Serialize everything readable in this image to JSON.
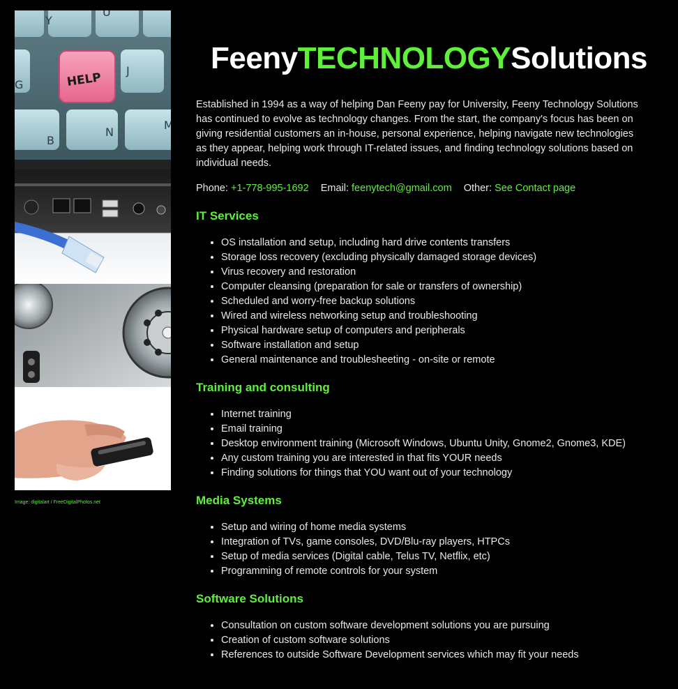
{
  "header": {
    "title_part1": "Feeny",
    "title_part2": "TECHNOLOGY",
    "title_part3": "Solutions"
  },
  "intro": "Established in 1994 as a way of helping Dan Feeny pay for University, Feeny Technology Solutions has continued to evolve as technology changes. From the start, the company's focus has been on giving residential customers an in-house, personal experience, helping navigate new technologies as they appear, helping work through IT-related issues, and finding technology solutions based on individual needs.",
  "contact": {
    "phone_label": "Phone:",
    "phone": "+1-778-995-1692",
    "email_label": "Email:",
    "email": "feenytech@gmail.com",
    "other_label": "Other:",
    "other_link": "See Contact page"
  },
  "sidebar": {
    "help_key_label": "HELP",
    "key_labels": [
      "Y",
      "U",
      "G",
      "J",
      "B",
      "N",
      "M"
    ],
    "credit": "Image: digitalart / FreeDigitalPhotos.net"
  },
  "sections": [
    {
      "title": "IT Services",
      "items": [
        "OS installation and setup, including hard drive contents transfers",
        "Storage loss recovery (excluding physically damaged storage devices)",
        "Virus recovery and restoration",
        "Computer cleansing (preparation for sale or transfers of ownership)",
        "Scheduled and worry-free backup solutions",
        "Wired and wireless networking setup and troubleshooting",
        "Physical hardware setup of computers and peripherals",
        "Software installation and setup",
        "General maintenance and troublesheeting - on-site or remote"
      ]
    },
    {
      "title": "Training and consulting",
      "items": [
        "Internet training",
        "Email training",
        "Desktop environment training (Microsoft Windows, Ubuntu Unity, Gnome2, Gnome3, KDE)",
        "Any custom training you are interested in that fits YOUR needs",
        "Finding solutions for things that YOU want out of your technology"
      ]
    },
    {
      "title": "Media Systems",
      "items": [
        "Setup and wiring of home media systems",
        "Integration of TVs, game consoles, DVD/Blu-ray players, HTPCs",
        "Setup of media services (Digital cable, Telus TV, Netflix, etc)",
        "Programming of remote controls for your system"
      ]
    },
    {
      "title": "Software Solutions",
      "items": [
        "Consultation on custom software development solutions you are pursuing",
        "Creation of custom software solutions",
        "References to outside Software Development services which may fit your needs"
      ]
    }
  ],
  "colors": {
    "accent": "#5ef03a",
    "background": "#000000",
    "text": "#e8e8e8"
  }
}
